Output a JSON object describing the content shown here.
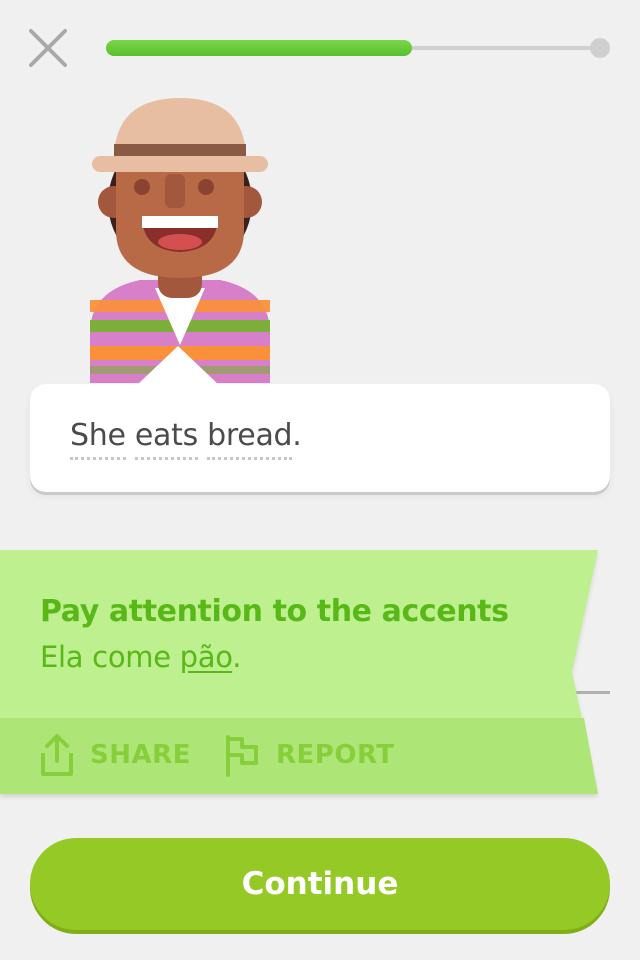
{
  "header": {
    "close_icon": "close-icon",
    "progress": 0.62
  },
  "prompt": {
    "words": [
      "She",
      "eats",
      "bread"
    ],
    "punctuation": "."
  },
  "feedback": {
    "title": "Pay attention to the accents",
    "answer_before": "Ela come ",
    "answer_highlight": "pão",
    "answer_after": ".",
    "share_label": "SHARE",
    "share_icon": "share-icon",
    "report_label": "REPORT",
    "report_icon": "flag-icon"
  },
  "footer": {
    "continue_label": "Continue"
  },
  "colors": {
    "accent_green": "#58b817",
    "banner_bg": "#bff08f",
    "button_green": "#95c925"
  }
}
